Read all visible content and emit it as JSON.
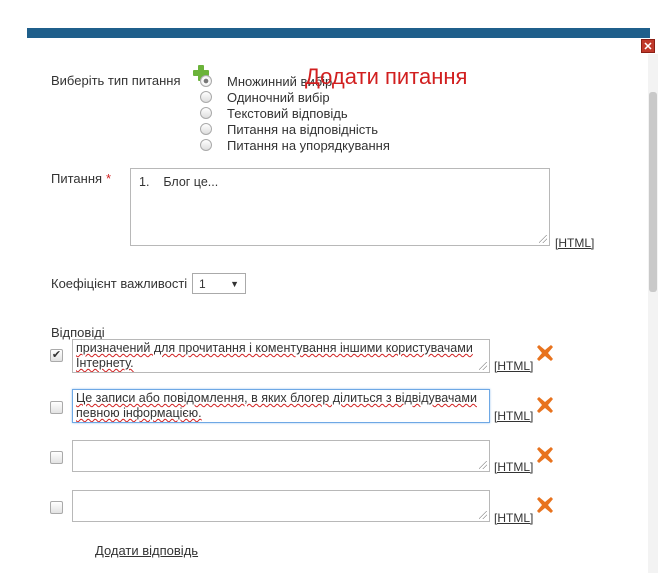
{
  "dialog": {
    "title": "Додати питання",
    "colors": {
      "topbar": "#1f5f8b",
      "title": "#d11f1f",
      "delete_icon": "#e8731e",
      "add_icon": "#6bb33a"
    }
  },
  "question_type": {
    "label": "Виберіть тип питання",
    "options": [
      {
        "label": "Множинний вибір",
        "selected": true
      },
      {
        "label": "Одиночний вибір",
        "selected": false
      },
      {
        "label": "Текстовий відповідь",
        "selected": false
      },
      {
        "label": "Питання на відповідність",
        "selected": false
      },
      {
        "label": "Питання на упорядкування",
        "selected": false
      }
    ]
  },
  "question": {
    "label": "Питання",
    "required_mark": "*",
    "value": "1.    Блог це...",
    "html_link": "[HTML]"
  },
  "weight": {
    "label": "Коефіцієнт важливості",
    "value": "1"
  },
  "answers": {
    "label": "Відповіді",
    "items": [
      {
        "checked": true,
        "value": "призначений для прочитання і коментування іншими користувачами Інтернету.",
        "html_link": "[HTML]"
      },
      {
        "checked": false,
        "value": "Це записи або повідомлення, в яких блогер ділиться з відвідувачами певною інформацією.",
        "html_link": "[HTML]"
      },
      {
        "checked": false,
        "value": "",
        "html_link": "[HTML]"
      },
      {
        "checked": false,
        "value": "",
        "html_link": "[HTML]"
      }
    ],
    "add_label": "Додати відповідь"
  }
}
